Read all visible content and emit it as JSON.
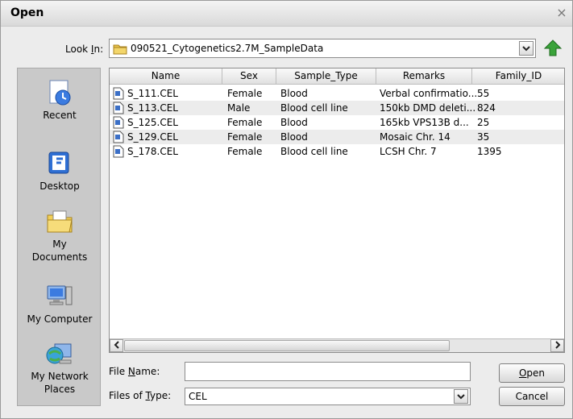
{
  "window": {
    "title": "Open",
    "close_glyph": "×"
  },
  "look_in": {
    "label_pre": "Look ",
    "label_ul": "I",
    "label_post": "n:",
    "value": "090521_Cytogenetics2.7M_SampleData"
  },
  "places": [
    {
      "label": "Recent",
      "icon": "recent-clock-icon"
    },
    {
      "label": "Desktop",
      "icon": "desktop-icon"
    },
    {
      "label": "My Documents",
      "icon": "my-documents-icon"
    },
    {
      "label": "My Computer",
      "icon": "my-computer-icon"
    },
    {
      "label": "My Network Places",
      "icon": "network-places-icon"
    }
  ],
  "file_list": {
    "columns": [
      "Name",
      "Sex",
      "Sample_Type",
      "Remarks",
      "Family_ID"
    ],
    "rows": [
      {
        "name": "S_111.CEL",
        "sex": "Female",
        "sample_type": "Blood",
        "remarks": "Verbal confirmatio...",
        "family_id": "55"
      },
      {
        "name": "S_113.CEL",
        "sex": "Male",
        "sample_type": "Blood cell line",
        "remarks": "150kb DMD deleti...",
        "family_id": "824"
      },
      {
        "name": "S_125.CEL",
        "sex": "Female",
        "sample_type": "Blood",
        "remarks": "165kb VPS13B d...",
        "family_id": "25"
      },
      {
        "name": "S_129.CEL",
        "sex": "Female",
        "sample_type": "Blood",
        "remarks": "Mosaic Chr. 14",
        "family_id": "35"
      },
      {
        "name": "S_178.CEL",
        "sex": "Female",
        "sample_type": "Blood cell line",
        "remarks": "LCSH Chr. 7",
        "family_id": "1395"
      }
    ]
  },
  "file_name": {
    "label_pre": "File ",
    "label_ul": "N",
    "label_post": "ame:",
    "value": ""
  },
  "files_of_type": {
    "label_pre": "Files of ",
    "label_ul": "T",
    "label_post": "ype:",
    "value": "CEL"
  },
  "buttons": {
    "open_ul": "O",
    "open_rest": "pen",
    "cancel": "Cancel"
  },
  "colors": {
    "folder": "#e7c24a",
    "up_arrow": "#3aa33a",
    "file_icon_blue": "#3b6fc6"
  }
}
